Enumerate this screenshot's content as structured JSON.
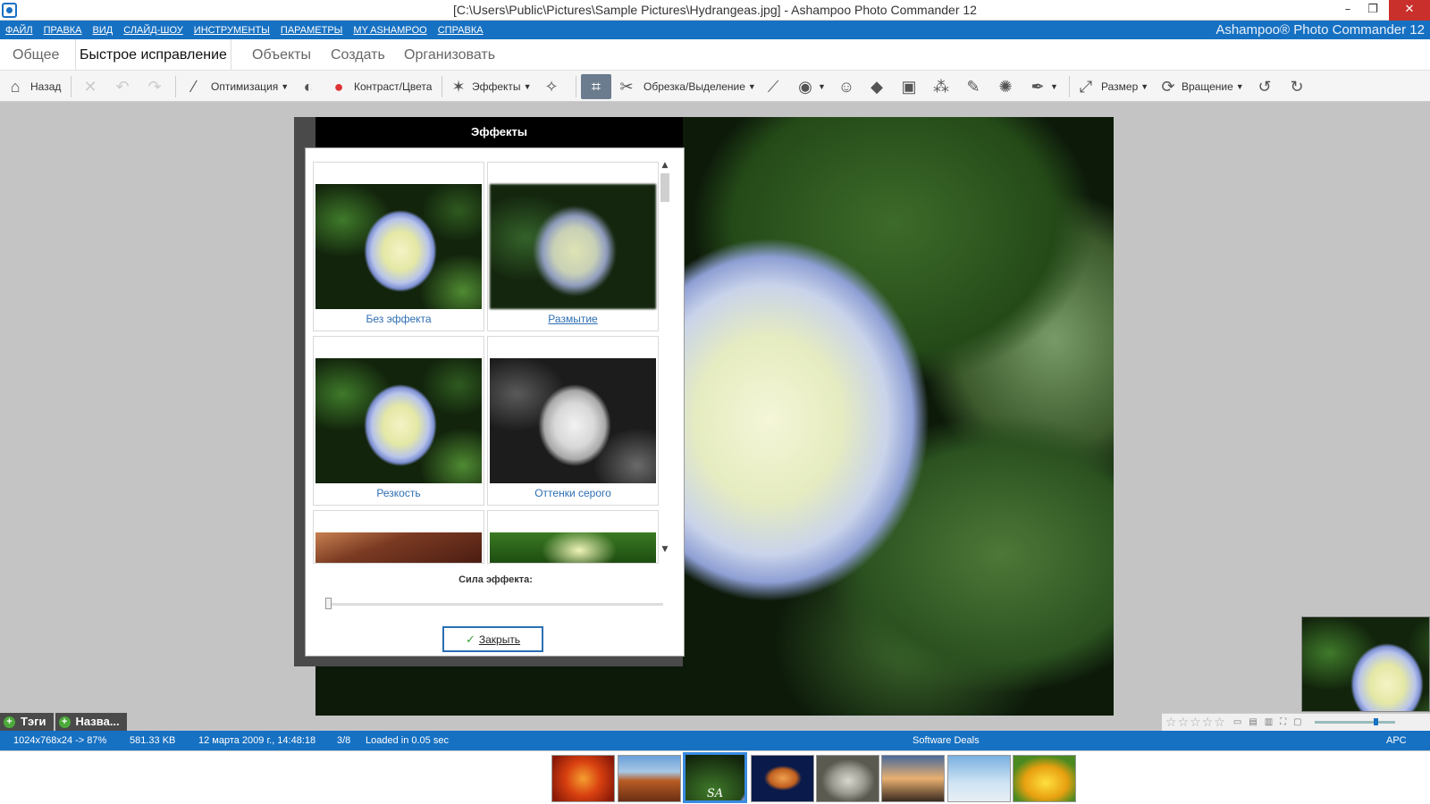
{
  "window": {
    "title": "[C:\\Users\\Public\\Pictures\\Sample Pictures\\Hydrangeas.jpg] - Ashampoo Photo Commander 12",
    "minimize": "–",
    "maximize": "❐",
    "close": "✕"
  },
  "menu": {
    "items": [
      "ФАЙЛ",
      "ПРАВКА",
      "ВИД",
      "СЛАЙД-ШОУ",
      "ИНСТРУМЕНТЫ",
      "ПАРАМЕТРЫ",
      "MY ASHAMPOO",
      "СПРАВКА"
    ],
    "brand": "Ashampoo® Photo Commander 12"
  },
  "tabs": {
    "general": "Общее",
    "quick_fix": "Быстрое исправление",
    "objects": "Объекты",
    "create": "Создать",
    "organize": "Организовать",
    "active": "quick_fix"
  },
  "toolbar": {
    "back": "Назад",
    "optimize": "Оптимизация",
    "contrast_color": "Контраст/Цвета",
    "effects": "Эффекты",
    "crop_select": "Обрезка/Выделение",
    "resize": "Размер",
    "rotate": "Вращение"
  },
  "effects_dialog": {
    "title": "Эффекты",
    "items": [
      "Без эффекта",
      "Размытие",
      "Резкость",
      "Оттенки серого"
    ],
    "strength_label": "Сила эффекта:",
    "strength_value": 0,
    "close_label": "Закрыть"
  },
  "tag_tabs": {
    "tags": "Тэги",
    "name": "Назва..."
  },
  "statusbar": {
    "dimensions": "1024x768x24 -> 87%",
    "filesize": "581.33 KB",
    "date": "12 марта 2009 г., 14:48:18",
    "position": "3/8",
    "load_time": "Loaded in 0.05 sec",
    "promo": "Software Deals",
    "keyboard": "APC"
  },
  "filmstrip": {
    "active_index": 2,
    "thumb_badge": "SA",
    "count": 8
  },
  "rating": {
    "stars": 0,
    "max": 5
  },
  "colors": {
    "accent": "#1771c2",
    "dialog_header": "#000000",
    "link": "#2d6eb3"
  }
}
